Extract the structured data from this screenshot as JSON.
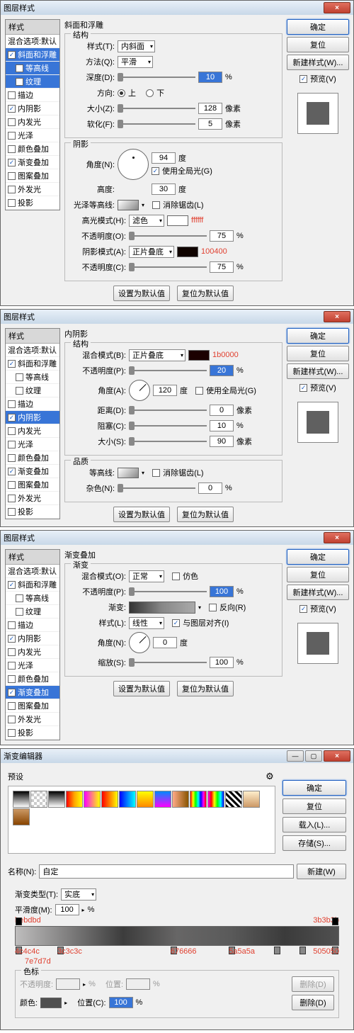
{
  "dialog_title": "图层样式",
  "styles_header": "样式",
  "blend_default": "混合选项:默认",
  "style_items": [
    {
      "label": "斜面和浮雕",
      "on": true
    },
    {
      "label": "等高线",
      "on": false,
      "sub": true
    },
    {
      "label": "纹理",
      "on": false,
      "sub": true
    },
    {
      "label": "描边",
      "on": false
    },
    {
      "label": "内阴影",
      "on": true
    },
    {
      "label": "内发光",
      "on": false
    },
    {
      "label": "光泽",
      "on": false
    },
    {
      "label": "颜色叠加",
      "on": false
    },
    {
      "label": "渐变叠加",
      "on": true
    },
    {
      "label": "图案叠加",
      "on": false
    },
    {
      "label": "外发光",
      "on": false
    },
    {
      "label": "投影",
      "on": false
    }
  ],
  "buttons": {
    "ok": "确定",
    "cancel": "复位",
    "new_style": "新建样式(W)...",
    "preview": "预览(V)",
    "set_default": "设置为默认值",
    "reset_default": "复位为默认值",
    "load": "载入(L)...",
    "save": "存储(S)...",
    "new": "新建(W)",
    "delete": "删除(D)"
  },
  "p1": {
    "section": "斜面和浮雕",
    "g1": "结构",
    "style_l": "样式(T):",
    "style_v": "内斜面",
    "method_l": "方法(Q):",
    "method_v": "平滑",
    "depth_l": "深度(D):",
    "depth_v": "10",
    "pct": "%",
    "dir_l": "方向:",
    "up": "上",
    "down": "下",
    "size_l": "大小(Z):",
    "size_v": "128",
    "px": "像素",
    "soften_l": "软化(F):",
    "soften_v": "5",
    "g2": "阴影",
    "angle_l": "角度(N):",
    "angle_v": "94",
    "deg": "度",
    "global_l": "使用全局光(G)",
    "alt_l": "高度:",
    "alt_v": "30",
    "gloss_l": "光泽等高线:",
    "anti_l": "消除锯齿(L)",
    "hl_mode_l": "高光模式(H):",
    "hl_mode_v": "滤色",
    "hl_color": "ffffff",
    "opac_l": "不透明度(O):",
    "hl_opac_v": "75",
    "sh_mode_l": "阴影模式(A):",
    "sh_mode_v": "正片叠底",
    "sh_color": "100400",
    "sh_opac_l": "不透明度(C):",
    "sh_opac_v": "75"
  },
  "p2": {
    "section": "内阴影",
    "g1": "结构",
    "blend_l": "混合模式(B):",
    "blend_v": "正片叠底",
    "blend_color": "1b0000",
    "opac_l": "不透明度(P):",
    "opac_v": "20",
    "angle_l": "角度(A):",
    "angle_v": "120",
    "deg": "度",
    "global_l": "使用全局光(G)",
    "dist_l": "距离(D):",
    "dist_v": "0",
    "px": "像素",
    "choke_l": "阻塞(C):",
    "choke_v": "10",
    "pct": "%",
    "size_l": "大小(S):",
    "size_v": "90",
    "g2": "品质",
    "contour_l": "等高线:",
    "anti_l": "消除锯齿(L)",
    "noise_l": "杂色(N):",
    "noise_v": "0"
  },
  "p3": {
    "section": "渐变叠加",
    "g1": "渐变",
    "blend_l": "混合模式(O):",
    "blend_v": "正常",
    "dither_l": "仿色",
    "opac_l": "不透明度(P):",
    "opac_v": "100",
    "pct": "%",
    "grad_l": "渐变:",
    "reverse_l": "反向(R)",
    "style_l": "样式(L):",
    "style_v": "线性",
    "align_l": "与图层对齐(I)",
    "angle_l": "角度(N):",
    "angle_v": "0",
    "deg": "度",
    "scale_l": "缩放(S):",
    "scale_v": "100"
  },
  "p4": {
    "title": "渐变编辑器",
    "presets_l": "预设",
    "name_l": "名称(N):",
    "name_v": "自定",
    "gtype_l": "渐变类型(T):",
    "gtype_v": "实底",
    "smooth_l": "平滑度(M):",
    "smooth_v": "100",
    "pct": "%",
    "stops": [
      "bebdbd",
      "7e7d7d",
      "3c3c3c",
      "676666",
      "5a5a5a",
      "3b3b3b",
      "505050",
      "4c4c4c"
    ],
    "color_stops_l": "色标",
    "opac_l": "不透明度:",
    "pos_l": "位置:",
    "color_l": "颜色:",
    "pos2_l": "位置(C):",
    "pos2_v": "100"
  }
}
